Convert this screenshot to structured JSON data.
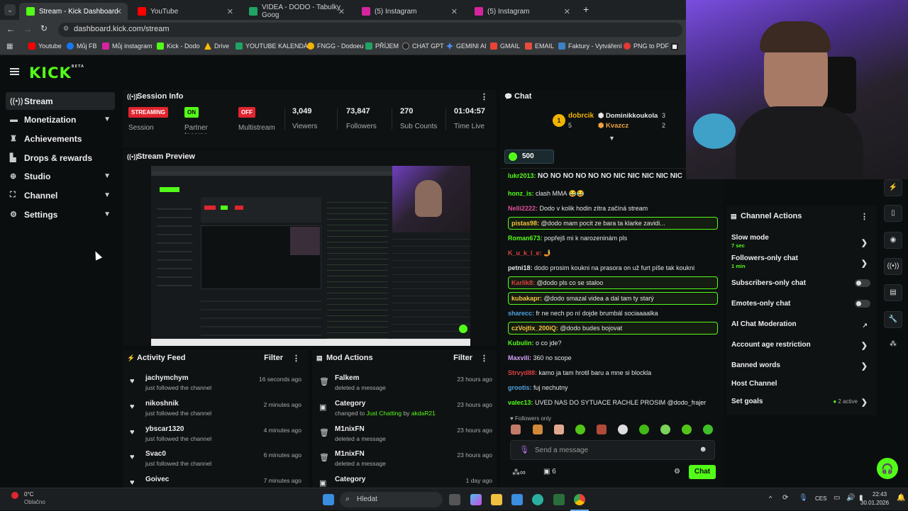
{
  "browser": {
    "tabs": [
      {
        "label": "Stream - Kick Dashboard",
        "color": "#53fc18",
        "active": true
      },
      {
        "label": "YouTube",
        "color": "#ff0000"
      },
      {
        "label": "VIDEA - DODO - Tabulky Goog",
        "color": "#1fa463"
      },
      {
        "label": "(5) Instagram",
        "color": "#d6249f"
      },
      {
        "label": "(5) Instagram",
        "color": "#d6249f"
      }
    ],
    "new_tab": "+",
    "url": "dashboard.kick.com/stream",
    "bookmarks": [
      {
        "label": "Youtube",
        "color": "#ff0000"
      },
      {
        "label": "Můj FB",
        "color": "#1877f2"
      },
      {
        "label": "Můj instagram",
        "color": "#d6249f"
      },
      {
        "label": "Kick - Dodo",
        "color": "#53fc18"
      },
      {
        "label": "Drive",
        "color": "#fbbc04"
      },
      {
        "label": "YOUTUBE KALENDÁŘ",
        "color": "#1fa463"
      },
      {
        "label": "FNGG - Dodoeu",
        "color": "#f5b400"
      },
      {
        "label": "PŘÍJEM",
        "color": "#1fa463"
      },
      {
        "label": "CHAT GPT",
        "color": "#222222"
      },
      {
        "label": "GEMINI AI",
        "color": "#4c8df6"
      },
      {
        "label": "GMAIL",
        "color": "#ea4335"
      },
      {
        "label": "EMAIL",
        "color": "#e74c3c"
      },
      {
        "label": "Faktury - Vytváření",
        "color": "#3b82c4"
      },
      {
        "label": "PNG to PDF",
        "color": "#e53935"
      }
    ]
  },
  "kick": {
    "logo": "KICK",
    "logo_sup": "BETA",
    "nav": [
      {
        "label": "Stream",
        "icon": "stream-icon",
        "active": true
      },
      {
        "label": "Monetization",
        "icon": "money-icon",
        "chevron": true
      },
      {
        "label": "Achievements",
        "icon": "trophy-icon"
      },
      {
        "label": "Drops & rewards",
        "icon": "gift-icon"
      },
      {
        "label": "Studio",
        "icon": "studio-icon",
        "chevron": true
      },
      {
        "label": "Channel",
        "icon": "channel-icon",
        "chevron": true
      },
      {
        "label": "Settings",
        "icon": "gear-icon",
        "chevron": true
      }
    ],
    "session": {
      "title": "Session Info",
      "streaming_badge": "STREAMING",
      "streaming_label": "Session",
      "partner_badge": "ON",
      "partner_label": "Partner Income",
      "multistream_badge": "OFF",
      "multistream_label": "Multistream",
      "viewers": "3,049",
      "viewers_label": "Viewers",
      "followers": "73,847",
      "followers_label": "Followers",
      "subs": "270",
      "subs_label": "Sub Counts",
      "time": "01:04:57",
      "time_label": "Time Live"
    },
    "preview": {
      "title": "Stream Preview"
    },
    "activity": {
      "title": "Activity Feed",
      "filter": "Filter",
      "items": [
        {
          "name": "jachymchym",
          "sub": "just followed the channel",
          "time": "16 seconds ago"
        },
        {
          "name": "nikoshnik",
          "sub": "just followed the channel",
          "time": "2 minutes ago"
        },
        {
          "name": "ybscar1320",
          "sub": "just followed the channel",
          "time": "4 minutes ago"
        },
        {
          "name": "Svac0",
          "sub": "just followed the channel",
          "time": "6 minutes ago"
        },
        {
          "name": "Goivec",
          "sub": "",
          "time": "7 minutes ago"
        }
      ]
    },
    "mod": {
      "title": "Mod Actions",
      "filter": "Filter",
      "items": [
        {
          "name": "Falkem",
          "sub": "deleted a message",
          "time": "23 hours ago"
        },
        {
          "name": "Category",
          "sub_pre": "changed to",
          "sub_hl": "Just Chatting",
          "sub_by": "by",
          "sub_user": "akdaR21",
          "time": "23 hours ago"
        },
        {
          "name": "M1nixFN",
          "sub": "deleted a message",
          "time": "23 hours ago"
        },
        {
          "name": "M1nixFN",
          "sub": "deleted a message",
          "time": "23 hours ago"
        },
        {
          "name": "Category",
          "sub": "",
          "time": "1 day ago"
        }
      ]
    },
    "chat": {
      "title": "Chat",
      "top1": {
        "name": "dobrcik",
        "rank": "1",
        "count": "5"
      },
      "top2": {
        "name": "Dominikkoukola",
        "count": "3"
      },
      "top3": {
        "name": "Kvazcz",
        "count": "2"
      },
      "kicks": "500",
      "messages": [
        {
          "user": "lukr2013:",
          "text": "NO NO NO NO NO NO NIC NIC NIC NIC NIC",
          "color": "#53fc18"
        },
        {
          "user": "honz_is:",
          "text": "clash MMA 😂😂",
          "color": "#53fc18"
        },
        {
          "user": "Nelli2222:",
          "text": "Dodo v kolik hodin zítra začíná stream",
          "color": "#e0509a"
        },
        {
          "user": "pistas98:",
          "text": "@dodo mam pocit ze bara ta klarke zavidi...",
          "color": "#f5c542",
          "hl": true
        },
        {
          "user": "Roman673:",
          "text": "popřejš mi k narozeninám pls",
          "color": "#53fc18"
        },
        {
          "user": "K_u_k_l_e:",
          "text": "🤳",
          "color": "#d94040"
        },
        {
          "user": "petni18:",
          "text": "dodo prosim koukni na prasora on už furt píše tak koukni",
          "color": "#e6e6e6"
        },
        {
          "user": "Karlik8:",
          "text": "@dodo pls co se staloo",
          "color": "#d94040",
          "hl": true
        },
        {
          "user": "kubakapr:",
          "text": "@dodo smazal videa a dal tam ty starý",
          "color": "#f5c542",
          "hl": true
        },
        {
          "user": "sharecc:",
          "text": "fr ne nech po ní dojde brumbál sociaaaalka",
          "color": "#4fa3e0"
        },
        {
          "user": "czVojtix_200iQ:",
          "text": "@dodo budes bojovat",
          "color": "#f5c542",
          "hl": true
        },
        {
          "user": "Kubulin:",
          "text": "o co jde?",
          "color": "#53fc18"
        },
        {
          "user": "Maxvili:",
          "text": "360 no scope",
          "color": "#d3a0f5"
        },
        {
          "user": "Strvyd88:",
          "text": "kamo ja tam hrotil baru a mne si blockla",
          "color": "#d94040"
        },
        {
          "user": "grootis:",
          "text": "fuj nechutny",
          "color": "#4fa3e0"
        },
        {
          "user": "valec13:",
          "text": "UVED NAS DO SYTUACE RACHLE PROSIM @dodo_frajer",
          "color": "#53fc18"
        }
      ],
      "followers_only": "Followers only",
      "placeholder": "Send a message",
      "count": "6",
      "send": "Chat"
    },
    "channel_actions": {
      "title": "Channel Actions",
      "items": [
        {
          "label": "Slow mode",
          "sub": "7 sec",
          "type": "arrow"
        },
        {
          "label": "Followers-only chat",
          "sub": "1 min",
          "type": "arrow"
        },
        {
          "label": "Subscribers-only chat",
          "type": "toggle"
        },
        {
          "label": "Emotes-only chat",
          "type": "toggle"
        },
        {
          "label": "AI Chat Moderation",
          "type": "link"
        },
        {
          "label": "Account age restriction",
          "type": "arrow"
        },
        {
          "label": "Banned words",
          "type": "arrow"
        },
        {
          "label": "Host Channel",
          "type": "none"
        },
        {
          "label": "Set goals",
          "sub_right": "2 active",
          "type": "arrow"
        }
      ]
    }
  },
  "taskbar": {
    "weather_temp": "0°C",
    "weather_text": "Oblačno",
    "search": "Hledat",
    "lang": "CES",
    "time": "22:43",
    "date": "30.01.2026"
  }
}
